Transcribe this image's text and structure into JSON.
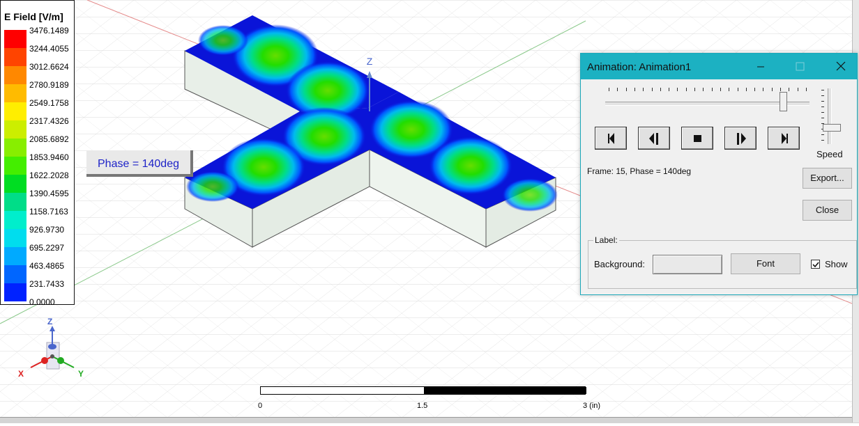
{
  "legend": {
    "title": "E Field [V/m]",
    "values": [
      "3476.1489",
      "3244.4055",
      "3012.6624",
      "2780.9189",
      "2549.1758",
      "2317.4326",
      "2085.6892",
      "1853.9460",
      "1622.2028",
      "1390.4595",
      "1158.7163",
      "926.9730",
      "695.2297",
      "463.4865",
      "231.7433",
      "0.0000"
    ],
    "colors": [
      "#ff0000",
      "#ff4400",
      "#ff8800",
      "#ffbb00",
      "#ffee00",
      "#ccee00",
      "#88ee00",
      "#44ee00",
      "#00dd22",
      "#00dd88",
      "#00eecc",
      "#00ddee",
      "#00aaff",
      "#0066ff",
      "#0022ff"
    ]
  },
  "phase_label": "Phase = 140deg",
  "axis": {
    "z": "Z",
    "x": "X",
    "y": "Y"
  },
  "scale": {
    "labels": [
      "0",
      "1.5",
      "3 (in)"
    ]
  },
  "dialog": {
    "title": "Animation: Animation1",
    "frame_text": "Frame: 15, Phase = 140deg",
    "speed_label": "Speed",
    "export_label": "Export...",
    "close_label": "Close",
    "label_group_title": "Label:",
    "background_label": "Background:",
    "font_label": "Font",
    "show_label": "Show",
    "show_checked": true,
    "slider_position": 0.9,
    "speed_position": 0.7
  },
  "colors": {
    "dialog_titlebar": "#1cb1c2",
    "phase_text": "#1e23c8",
    "model_blue": "#0a14d8"
  }
}
